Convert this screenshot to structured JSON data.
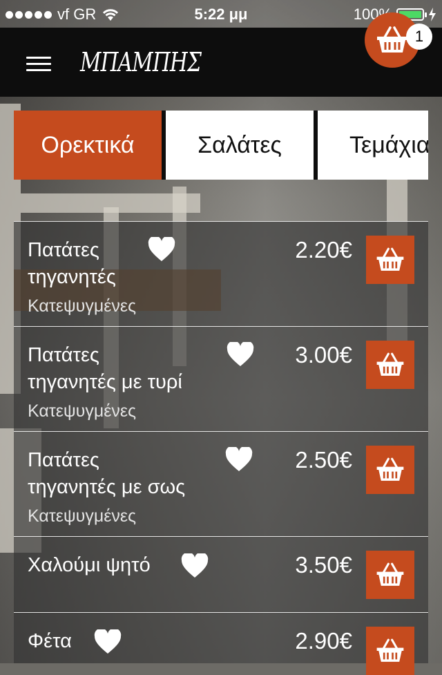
{
  "status_bar": {
    "carrier": "vf GR",
    "time": "5:22 μμ",
    "battery_percent": "100%",
    "battery_level": 1.0
  },
  "header": {
    "logo_text": "ΜΠΑΜΠΗΣ",
    "menu_icon": "hamburger-icon",
    "cart_icon": "basket-icon",
    "cart_count": "1"
  },
  "tabs": [
    {
      "label": "Ορεκτικά",
      "active": true
    },
    {
      "label": "Σαλάτες",
      "active": false
    },
    {
      "label": "Τεμάχια",
      "active": false
    }
  ],
  "items": [
    {
      "name_line1": "Πατάτες",
      "name_line2": "τηγανητές",
      "subtitle": "Κατεψυγμένες",
      "price": "2.20€"
    },
    {
      "name_line1": "Πατάτες",
      "name_line2": "τηγανητές με τυρί",
      "subtitle": "Κατεψυγμένες",
      "price": "3.00€"
    },
    {
      "name_line1": "Πατάτες",
      "name_line2": "τηγανητές με σως",
      "subtitle": "Κατεψυγμένες",
      "price": "2.50€"
    },
    {
      "name_line1": "Χαλούμι ψητό",
      "name_line2": "",
      "subtitle": "",
      "price": "3.50€"
    },
    {
      "name_line1": "Φέτα",
      "name_line2": "",
      "subtitle": "",
      "price": "2.90€"
    }
  ],
  "colors": {
    "accent": "#c54b1e",
    "navbar": "#0d0d0d",
    "battery": "#4cd964"
  }
}
